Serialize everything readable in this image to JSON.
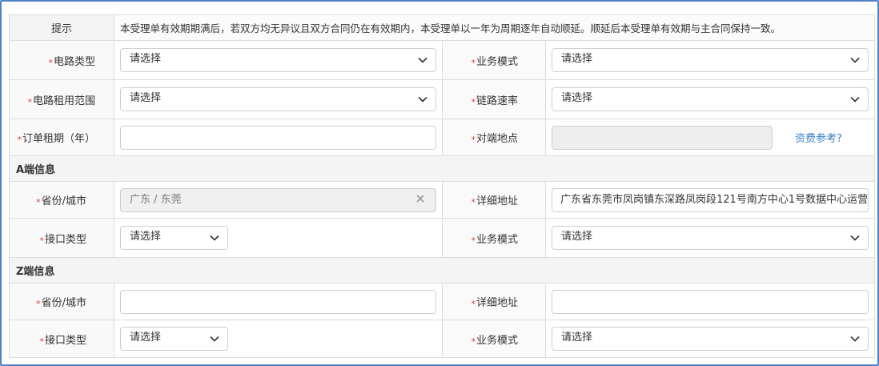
{
  "tip": {
    "label": "提示",
    "text": "本受理单有效期期满后，若双方均无异议且双方合同仍在有效期内，本受理单以一年为周期逐年自动顺延。顺延后本受理单有效期与主合同保持一致。"
  },
  "required_mark": "*",
  "rows": {
    "circuit_type": {
      "label": "电路类型",
      "value": "请选择"
    },
    "business_mode_1": {
      "label": "业务模式",
      "value": "请选择"
    },
    "circuit_scope": {
      "label": "电路租用范围",
      "value": "请选择"
    },
    "link_rate": {
      "label": "链路速率",
      "value": "请选择"
    },
    "order_term": {
      "label": "订单租期（年）",
      "value": ""
    },
    "remote_site": {
      "label": "对端地点",
      "value": "",
      "link": "资费参考?"
    }
  },
  "a_end": {
    "title": "A端信息",
    "province_label": "省份/城市",
    "province_value": "广东 / 东莞",
    "address_label": "详细地址",
    "address_value": "广东省东莞市凤岗镇东深路凤岗段121号南方中心1号数据中心运营",
    "interface_label": "接口类型",
    "interface_value": "请选择",
    "mode_label": "业务模式",
    "mode_value": "请选择"
  },
  "z_end": {
    "title": "Z端信息",
    "province_label": "省份/城市",
    "province_value": "",
    "address_label": "详细地址",
    "address_value": "",
    "interface_label": "接口类型",
    "interface_value": "请选择",
    "mode_label": "业务模式",
    "mode_value": "请选择"
  },
  "icons": {
    "dropdown": "chevron-down-icon",
    "clear": "close-icon"
  },
  "colors": {
    "required": "#e04040",
    "link": "#3a7fc4",
    "frame": "#4f81c7"
  }
}
